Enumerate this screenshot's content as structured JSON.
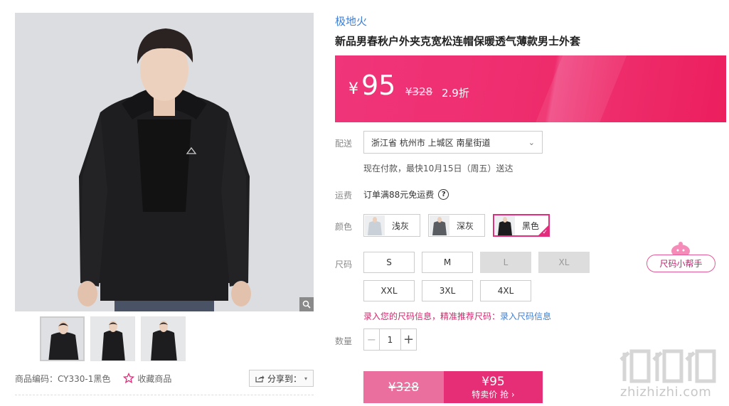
{
  "brand": "极地火",
  "title": "新品男春秋户外夹克宽松连帽保暖透气薄款男士外套",
  "price": {
    "currency": "¥",
    "current": "95",
    "original": "¥328",
    "discount": "2.9折"
  },
  "delivery": {
    "label": "配送",
    "address": "浙江省 杭州市 上城区 南星街道",
    "note": "现在付款，最快10月15日（周五）送达"
  },
  "shipping": {
    "label": "运费",
    "text": "订单满88元免运费",
    "help_icon": "question-circle-icon"
  },
  "color": {
    "label": "颜色",
    "options": [
      {
        "label": "浅灰",
        "swatch": "#c9d0d8",
        "selected": false
      },
      {
        "label": "深灰",
        "swatch": "#5a5d62",
        "selected": false
      },
      {
        "label": "黑色",
        "swatch": "#1c1c1e",
        "selected": true
      }
    ]
  },
  "size": {
    "label": "尺码",
    "options": [
      {
        "label": "S",
        "available": true
      },
      {
        "label": "M",
        "available": true
      },
      {
        "label": "L",
        "available": false
      },
      {
        "label": "XL",
        "available": false
      },
      {
        "label": "XXL",
        "available": true
      },
      {
        "label": "3XL",
        "available": true
      },
      {
        "label": "4XL",
        "available": true
      }
    ],
    "tip": "录入您的尺码信息，精准推荐尺码：",
    "tip_link": "录入尺码信息",
    "helper": "尺码小帮手"
  },
  "quantity": {
    "label": "数量",
    "value": "1",
    "minus": "−",
    "plus": "+"
  },
  "buy": {
    "original": "¥328",
    "price": "¥95",
    "action": "特卖价 抢 ›"
  },
  "gallery": {
    "product_code": "商品编码：CY330-1黑色",
    "favorite": "收藏商品",
    "share": "分享到："
  },
  "watermark": {
    "text": "zhizhizhi.com"
  },
  "colors": {
    "accent": "#ee2c6c",
    "link": "#3d7fd6",
    "select_border": "#e12d7c"
  }
}
